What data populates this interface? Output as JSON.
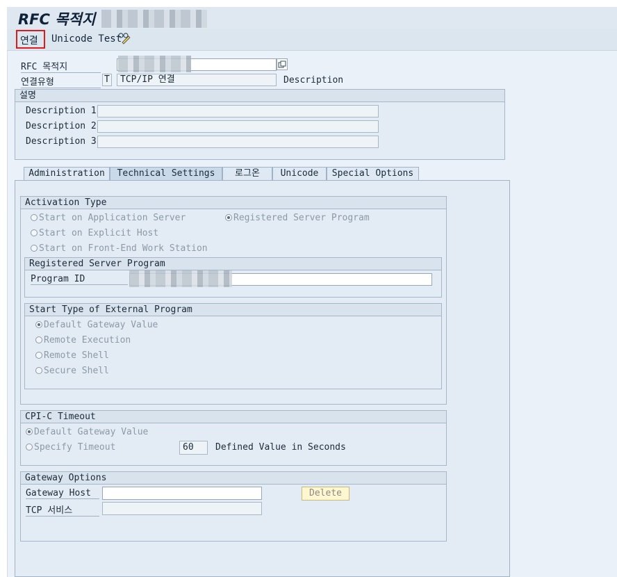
{
  "window": {
    "title": "RFC 목적지"
  },
  "toolbar": {
    "connect_label": "연결",
    "unicode_test_label": "Unicode Test",
    "glasses_icon": "glasses-icon"
  },
  "header": {
    "rfc_dest_label": "RFC 목적지",
    "conn_type_label": "연결유형",
    "conn_type_code": "T",
    "conn_type_value": "TCP/IP 연결",
    "description_label": "Description"
  },
  "desc_group": {
    "title": "설명",
    "desc1_label": "Description 1",
    "desc2_label": "Description 2",
    "desc3_label": "Description 3"
  },
  "tabs": [
    {
      "label": "Administration"
    },
    {
      "label": "Technical Settings"
    },
    {
      "label": "로그온"
    },
    {
      "label": "Unicode"
    },
    {
      "label": "Special Options"
    }
  ],
  "activation": {
    "title": "Activation Type",
    "opt_app_server": "Start on Application Server",
    "opt_registered": "Registered Server Program",
    "opt_explicit": "Start on Explicit Host",
    "opt_frontend": "Start on Front-End Work Station",
    "selected": "Registered Server Program"
  },
  "registered": {
    "title": "Registered Server Program",
    "program_id_label": "Program ID"
  },
  "start_type": {
    "title": "Start Type of External Program",
    "opt_default": "Default Gateway Value",
    "opt_remote_exec": "Remote Execution",
    "opt_remote_shell": "Remote Shell",
    "opt_secure_shell": "Secure Shell",
    "selected": "Default Gateway Value"
  },
  "cpic": {
    "title": "CPI-C Timeout",
    "opt_default": "Default Gateway Value",
    "opt_specify": "Specify Timeout",
    "timeout_value": "60",
    "defined_label": "Defined Value in Seconds",
    "selected": "Default Gateway Value"
  },
  "gateway": {
    "title": "Gateway Options",
    "host_label": "Gateway Host",
    "service_label": "TCP 서비스",
    "delete_label": "Delete"
  }
}
